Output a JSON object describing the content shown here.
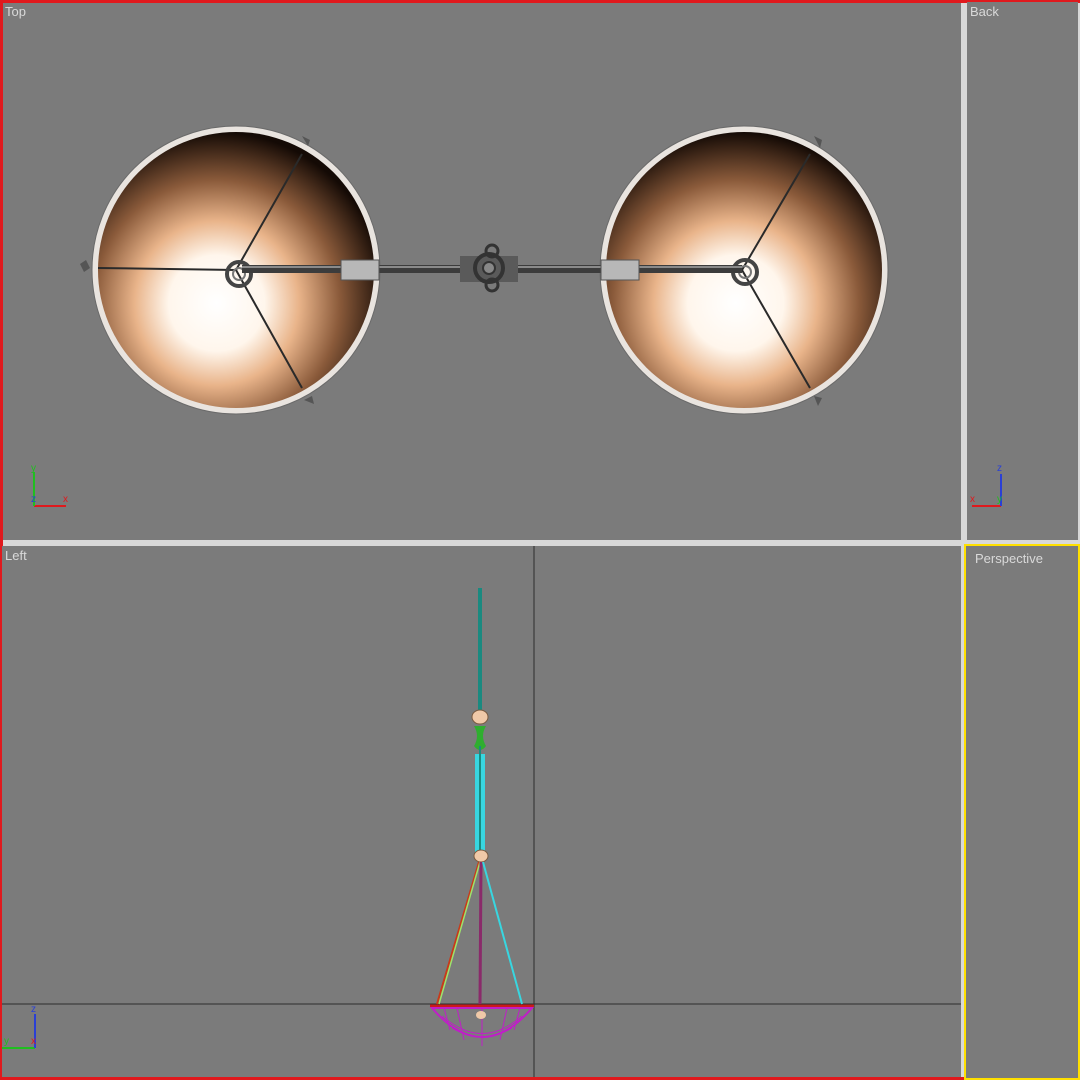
{
  "viewports": {
    "top": {
      "label": "Top"
    },
    "back": {
      "label": "Back"
    },
    "left": {
      "label": "Left"
    },
    "perspective": {
      "label": "Perspective"
    }
  },
  "axes": {
    "top": {
      "vertical": "y",
      "horizontal": "x",
      "center": "z"
    },
    "back": {
      "vertical": "z",
      "horizontal": "x",
      "center": "y"
    },
    "left": {
      "vertical": "z",
      "horizontal": "y",
      "center": "x"
    }
  },
  "colors": {
    "active_border": "#e0191d",
    "perspective_border": "#ffe000",
    "viewport_bg": "#7b7b7b",
    "axis_x": "#e0191d",
    "axis_y": "#1fbf1f",
    "axis_z": "#2a3fd6"
  }
}
